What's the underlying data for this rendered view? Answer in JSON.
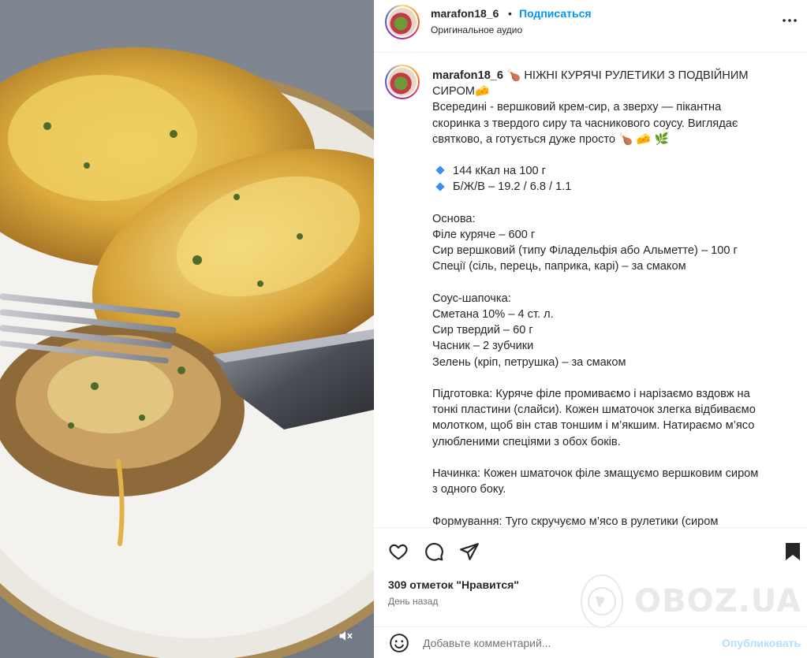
{
  "post": {
    "username": "marafon18_6",
    "separator": "•",
    "follow_label": "Подписаться",
    "audio_label": "Оригинальное аудио"
  },
  "caption": {
    "username": "marafon18_6",
    "lines": [
      "НІЖНІ КУРЯЧІ РУЛЕТИКИ З ПОДВІЙНИМ",
      "СИРОМ",
      "Всередині - вершковий крем-сир, а зверху — пікантна",
      "скоринка з твердого сиру та часникового соусу. Виглядає",
      "святково, а готується дуже просто",
      "",
      "144 кКал на 100 г",
      "Б/Ж/В – 19.2 / 6.8 / 1.1",
      "",
      "Основа:",
      "Філе куряче – 600 г",
      "Сир вершковий (типу Філадельфія або Альметте) – 100 г",
      "Спеції (сіль, перець, паприка, карі) – за смаком",
      "",
      "Соус-шапочка:",
      "Сметана 10% – 4 ст. л.",
      "Сир твердий – 60 г",
      "Часник – 2 зубчики",
      "Зелень (кріп, петрушка) – за смаком",
      "",
      "Підготовка: Куряче філе промиваємо і нарізаємо вздовж на",
      "тонкі пластини (слайси). Кожен шматочок злегка відбиваємо",
      "молотком, щоб він став тоншим і м’якшим. Натираємо м’ясо",
      "улюбленими спеціями з обох боків.",
      "",
      "Начинка: Кожен шматочок філе змащуємо вершковим сиром",
      "з одного боку.",
      "",
      "Формування: Туго скручуємо м’ясо в рулетики (сиром"
    ],
    "emojis": {
      "title_drumstick": "🍗",
      "title_cheese": "🧀",
      "tail": "🍗 🧀 🌿"
    }
  },
  "engagement": {
    "likes_text": "309 отметок \"Нравится\"",
    "date_text": "День назад"
  },
  "comment": {
    "placeholder": "Добавьте комментарий...",
    "post_label": "Опубликовать"
  },
  "watermark": {
    "text": "OBOZ.UA"
  },
  "colors": {
    "link_blue": "#0095f6",
    "post_disabled": "#b2dffc",
    "secondary_text": "#737373",
    "diamond_blue": "#3b8eea"
  },
  "icons": {
    "more": "more-icon",
    "like": "heart-icon",
    "comment": "comment-icon",
    "share": "send-icon",
    "save": "bookmark-icon",
    "emoji": "smiley-icon",
    "mute": "mute-icon"
  }
}
